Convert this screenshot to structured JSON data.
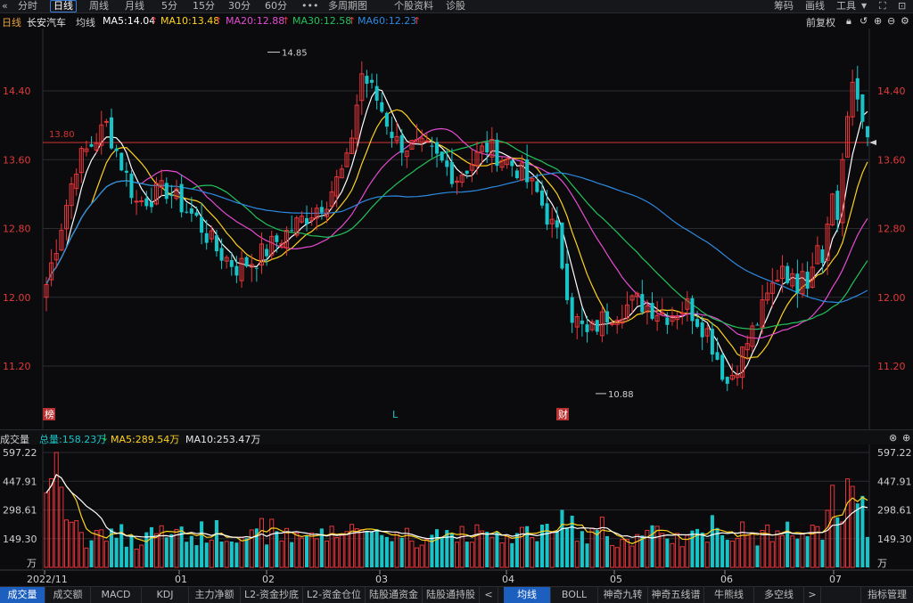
{
  "toolbar": {
    "tabs": [
      "分时",
      "日线",
      "周线",
      "月线",
      "5分",
      "15分",
      "30分",
      "60分",
      "•••",
      "多周期图",
      "个股资料",
      "诊股"
    ],
    "active": "日线",
    "right": [
      "筹码",
      "画线",
      "工具"
    ]
  },
  "info": {
    "period": "日线",
    "stock": "长安汽车",
    "indicator": "均线",
    "ma5": "MA5:14.04",
    "ma10": "MA10:13.48",
    "ma20": "MA20:12.88",
    "ma30": "MA30:12.58",
    "ma60": "MA60:12.23",
    "adjust": "前复权"
  },
  "volume_info": {
    "label": "成交量",
    "total": "总量:158.23万",
    "ma5": "MA5:289.54万",
    "ma10": "MA10:253.47万"
  },
  "bottom_tabs_left": [
    "成交量",
    "成交额",
    "MACD",
    "KDJ",
    "主力净额",
    "L2-资金抄底",
    "L2-资金仓位",
    "陆股通资金",
    "陆股通持股"
  ],
  "bottom_tabs_right": [
    "均线",
    "BOLL",
    "神奇九转",
    "神奇五线谱",
    "牛熊线",
    "多空线"
  ],
  "bottom_tab_manage": "指标管理",
  "colors": {
    "up": "#e8353a",
    "down": "#19c4c8",
    "ma5": "#ffffff",
    "ma10": "#ffd21f",
    "ma20": "#e54bd2",
    "ma30": "#22c35a",
    "ma60": "#2d88e0",
    "axis_text": "#e03a3a"
  },
  "chart_data": {
    "type": "candlestick",
    "price_axis": {
      "ticks": [
        14.4,
        13.6,
        12.8,
        12.0,
        11.2
      ],
      "labels": [
        "14.40",
        "13.60",
        "12.80",
        "12.00",
        "11.20"
      ]
    },
    "volume_axis": {
      "ticks": [
        597.22,
        447.91,
        298.61,
        149.3
      ],
      "labels": [
        "597.22",
        "447.91",
        "298.61",
        "149.30"
      ],
      "unit": "万"
    },
    "x_labels": [
      "2022/11",
      "01",
      "02",
      "03",
      "04",
      "05",
      "06",
      "07"
    ],
    "high_marker": {
      "value": 14.85,
      "label": "14.85"
    },
    "low_marker": {
      "value": 10.88,
      "label": "10.88"
    },
    "ref_line": {
      "value": 13.8,
      "label": "13.80"
    },
    "event_markers": [
      "榜",
      "L",
      "财"
    ],
    "ma_legend": [
      "MA5",
      "MA10",
      "MA20",
      "MA30",
      "MA60"
    ]
  }
}
